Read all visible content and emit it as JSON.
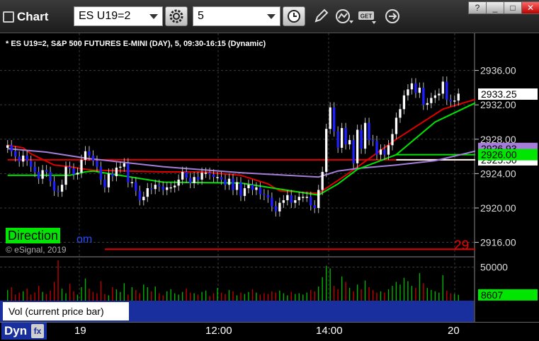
{
  "toolbar": {
    "app_title": "Chart",
    "symbol_value": "ES U19=2",
    "interval_value": "5",
    "get_label": "GET"
  },
  "window_buttons": [
    "?",
    "_",
    "□",
    "✕"
  ],
  "chart_header": "* ES U19=2, S&P 500 FUTURES E-MINI (DAY), 5, 09:30-16:15 (Dynamic)",
  "overlays": {
    "direction_label": "Direction",
    "partial_text": "om",
    "copyright": "© eSignal, 2019",
    "bars_remaining": "29"
  },
  "price_axis": {
    "ticks": [
      "2936.00",
      "2932.00",
      "2928.00",
      "2924.00",
      "2920.00",
      "2916.00"
    ],
    "tick_values": [
      2936,
      2932,
      2928,
      2924,
      2920,
      2916
    ],
    "flags": [
      {
        "label": "2933.25",
        "bg": "#ffffff",
        "fg": "#000000",
        "value": 2933.25
      },
      {
        "label": "2926.93",
        "bg": "#a67dd9",
        "fg": "#000000",
        "value": 2926.93
      },
      {
        "label": "2925.50",
        "bg": "#ffffff",
        "fg": "#000000",
        "value": 2925.6
      },
      {
        "label": "2926.00",
        "bg": "#00e600",
        "fg": "#000000",
        "value": 2926.2
      }
    ]
  },
  "volume": {
    "label": "Vol (current price bar)",
    "close_label": "x",
    "tick": "50000",
    "current": "8607"
  },
  "time_axis": {
    "dyn_label": "Dyn",
    "labels": [
      "19",
      "12:00",
      "14:00",
      "20"
    ]
  },
  "colors": {
    "up_candle": "#ffffff",
    "down_candle": "#1f1fff",
    "red_ma": "#e00000",
    "purple_ma": "#a67dd9",
    "green_ma": "#00e600",
    "vol_up": "#00b300",
    "vol_down": "#c00000",
    "grid": "#3a3a3a"
  },
  "chart_data": {
    "type": "candlestick",
    "ylim": [
      2914.4,
      2938.6
    ],
    "closes": [
      2927.3,
      2926.6,
      2926.0,
      2925.4,
      2926.1,
      2925.5,
      2924.8,
      2924.2,
      2923.4,
      2924.4,
      2924.2,
      2923.1,
      2922.0,
      2921.9,
      2922.7,
      2924.8,
      2924.6,
      2923.9,
      2924.1,
      2925.6,
      2926.6,
      2926.1,
      2925.5,
      2924.8,
      2923.3,
      2922.4,
      2924.0,
      2923.7,
      2924.7,
      2924.8,
      2925.2,
      2923.0,
      2923.0,
      2922.0,
      2920.9,
      2921.3,
      2922.3,
      2922.2,
      2922.7,
      2922.5,
      2922.1,
      2922.4,
      2922.4,
      2922.6,
      2923.3,
      2924.2,
      2923.5,
      2922.9,
      2923.6,
      2923.3,
      2924.1,
      2924.1,
      2923.9,
      2923.6,
      2923.6,
      2923.3,
      2922.7,
      2923.4,
      2922.1,
      2923.0,
      2921.4,
      2922.3,
      2922.7,
      2922.1,
      2922.4,
      2921.6,
      2921.5,
      2921.2,
      2920.2,
      2919.6,
      2920.6,
      2920.9,
      2921.5,
      2920.6,
      2920.9,
      2921.3,
      2921.3,
      2921.3,
      2920.3,
      2920.0,
      2922.1,
      2924.2,
      2929.2,
      2931.7,
      2928.9,
      2927.0,
      2929.3,
      2927.4,
      2927.9,
      2925.2,
      2929.1,
      2926.9,
      2929.9,
      2927.9,
      2927.8,
      2926.2,
      2926.8,
      2926.2,
      2927.3,
      2928.6,
      2930.5,
      2931.5,
      2933.1,
      2933.8,
      2934.5,
      2933.4,
      2934.0,
      2932.0,
      2932.2,
      2932.8,
      2933.1,
      2933.3,
      2934.7,
      2932.6,
      2932.4,
      2932.5,
      2933.3
    ],
    "series": [
      {
        "name": "red_ma",
        "x": [
          0,
          4,
          6,
          12,
          16,
          20,
          22,
          40,
          50,
          60,
          67,
          70,
          80,
          87,
          100,
          112,
          123
        ],
        "y": [
          2927.3,
          2927.0,
          2926.3,
          2925.0,
          2924.8,
          2924.5,
          2924.4,
          2924.2,
          2924.2,
          2923.8,
          2922.8,
          2922.0,
          2921.7,
          2923.8,
          2928.0,
          2931.5,
          2933.0
        ]
      },
      {
        "name": "purple_ma",
        "x": [
          0,
          10,
          20,
          40,
          60,
          80,
          85,
          90,
          100,
          110,
          123
        ],
        "y": [
          2926.9,
          2926.5,
          2925.8,
          2924.8,
          2924.1,
          2923.6,
          2924.3,
          2924.6,
          2925.0,
          2925.5,
          2926.9
        ]
      },
      {
        "name": "green_ma",
        "x": [
          0,
          16,
          18,
          20,
          22,
          40,
          60,
          80,
          85,
          90,
          100,
          110,
          123
        ],
        "y": [
          2923.8,
          2923.8,
          2924.0,
          2924.2,
          2924.3,
          2923.0,
          2922.9,
          2921.5,
          2922.8,
          2924.5,
          2926.2,
          2930.0,
          2932.8
        ]
      },
      {
        "name": "level_red",
        "x": [
          0,
          123
        ],
        "y": [
          2925.6,
          2925.6
        ]
      },
      {
        "name": "level_green",
        "x": [
          100,
          123
        ],
        "y": [
          2926.2,
          2926.2
        ]
      },
      {
        "name": "level_white",
        "x": [
          100,
          123
        ],
        "y": [
          2925.6,
          2925.6
        ]
      },
      {
        "name": "level_bottom_red",
        "x": [
          25,
          123
        ],
        "y": [
          2915.2,
          2915.2
        ]
      }
    ],
    "volume_ylim": [
      0,
      60000
    ],
    "volume": [
      16000,
      20000,
      9000,
      12000,
      14000,
      18000,
      9000,
      12000,
      22000,
      13000,
      10000,
      15000,
      28000,
      60000,
      18000,
      11000,
      25000,
      14000,
      9000,
      20000,
      33000,
      18000,
      13000,
      11000,
      29000,
      10000,
      8000,
      20000,
      17000,
      13000,
      26000,
      9000,
      20000,
      16000,
      11000,
      24000,
      20000,
      14000,
      21000,
      11000,
      8000,
      14000,
      17000,
      11000,
      9000,
      13000,
      18000,
      12000,
      11000,
      9000,
      13000,
      15000,
      7000,
      11000,
      19000,
      12000,
      10000,
      16000,
      14000,
      8000,
      12000,
      10000,
      13000,
      17000,
      12000,
      9000,
      11000,
      10000,
      14000,
      12000,
      15000,
      11000,
      8000,
      13000,
      10000,
      11000,
      9000,
      12000,
      16000,
      14000,
      21000,
      35000,
      52000,
      48000,
      22000,
      17000,
      36000,
      28000,
      19000,
      14000,
      24000,
      17000,
      30000,
      20000,
      16000,
      12000,
      14000,
      12000,
      17000,
      22000,
      28000,
      24000,
      34000,
      29000,
      22000,
      19000,
      41000,
      26000,
      19000,
      16000,
      14000,
      12000,
      38000,
      15000,
      11000,
      10000,
      8607
    ]
  }
}
